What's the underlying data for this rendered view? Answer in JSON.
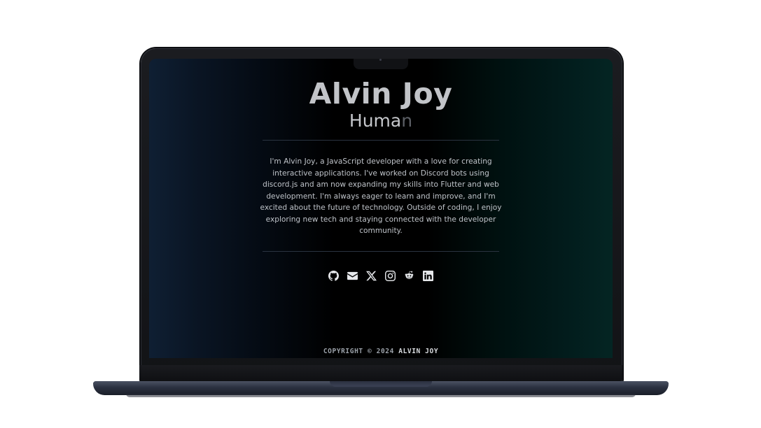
{
  "profile": {
    "name": "Alvin Joy",
    "role_visible": "Huma",
    "role_fading": "n",
    "bio": "I'm Alvin Joy, a JavaScript developer with a love for creating interactive applications. I've worked on Discord bots using discord.js and am now expanding my skills into Flutter and web development. I'm always eager to learn and improve, and I'm excited about the future of technology. Outside of coding, I enjoy exploring new tech and staying connected with the developer community."
  },
  "socials": [
    {
      "icon": "github-icon"
    },
    {
      "icon": "email-icon"
    },
    {
      "icon": "x-icon"
    },
    {
      "icon": "instagram-icon"
    },
    {
      "icon": "reddit-icon"
    },
    {
      "icon": "linkedin-icon"
    }
  ],
  "footer": {
    "prefix": "COPYRIGHT © 2024 ",
    "owner": "ALVIN JOY"
  },
  "colors": {
    "background_left": "#0f1f33",
    "background_center": "#000000",
    "background_right": "#042523",
    "text": "#bfc3c9",
    "heading": "#c2c4c8"
  }
}
